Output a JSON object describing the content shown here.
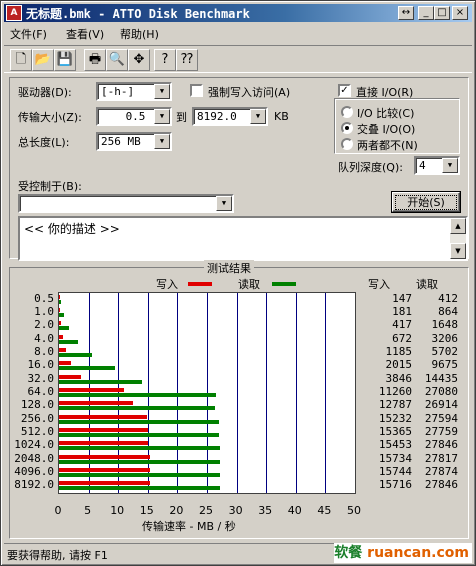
{
  "window": {
    "title": "无标题.bmk - ATTO Disk Benchmark",
    "buttons": {
      "resize": "↔",
      "minimize": "_",
      "maximize": "□",
      "close": "×"
    }
  },
  "menu": [
    "文件(F)",
    "查看(V)",
    "帮助(H)"
  ],
  "toolbar": [
    {
      "icon": "new-file-icon",
      "glyph": "🗋"
    },
    {
      "icon": "open-folder-icon",
      "glyph": "📂"
    },
    {
      "icon": "save-icon",
      "glyph": "💾"
    },
    {
      "icon": "print-icon",
      "glyph": "🖶"
    },
    {
      "icon": "print-preview-icon",
      "glyph": "🔍"
    },
    {
      "icon": "move-icon",
      "glyph": "✥"
    },
    {
      "icon": "help-icon",
      "glyph": "?"
    },
    {
      "icon": "context-help-icon",
      "glyph": "⁇"
    }
  ],
  "settings": {
    "drive_label": "驱动器(D):",
    "drive_value": "[-h-]",
    "transfer_label": "传输大小(Z):",
    "transfer_from": "0.5",
    "to_label": "到",
    "transfer_to": "8192.0",
    "kb_label": "KB",
    "length_label": "总长度(L):",
    "length_value": "256 MB",
    "force_write_label": "强制写入访问(A)",
    "force_write_checked": false,
    "direct_io_label": "直接 I/O(R)",
    "direct_io_checked": true,
    "io_compare_label": "I/O 比较(C)",
    "overlap_io_label": "交叠 I/O(O)",
    "neither_label": "两者都不(N)",
    "selected_mode": "overlap",
    "queue_label": "队列深度(Q):",
    "queue_value": "4",
    "controlled_label": "受控制于(B):",
    "controlled_value": "",
    "start_button": "开始(S)",
    "description": "<<  你的描述  >>"
  },
  "results": {
    "title": "测试结果",
    "write_legend": "写入",
    "read_legend": "读取",
    "write_header": "写入",
    "read_header": "读取",
    "xlabel": "传输速率 - MB / 秒"
  },
  "colors": {
    "write": "#e00000",
    "read": "#008000",
    "grid": "#000080"
  },
  "chart_data": {
    "type": "bar",
    "orientation": "horizontal",
    "categories": [
      "0.5",
      "1.0",
      "2.0",
      "4.0",
      "8.0",
      "16.0",
      "32.0",
      "64.0",
      "128.0",
      "256.0",
      "512.0",
      "1024.0",
      "2048.0",
      "4096.0",
      "8192.0"
    ],
    "series": [
      {
        "name": "写入",
        "values": [
          147,
          181,
          417,
          672,
          1185,
          2015,
          3846,
          11260,
          12787,
          15232,
          15365,
          15453,
          15734,
          15744,
          15716
        ]
      },
      {
        "name": "读取",
        "values": [
          412,
          864,
          1648,
          3206,
          5702,
          9675,
          14435,
          27080,
          26914,
          27594,
          27759,
          27846,
          27817,
          27874,
          27846
        ]
      }
    ],
    "value_unit_display": "KB/s",
    "xlabel": "传输速率 - MB / 秒",
    "xticks": [
      "0",
      "5",
      "10",
      "15",
      "20",
      "25",
      "30",
      "35",
      "40",
      "45",
      "50"
    ],
    "xlim": [
      0,
      50
    ],
    "grid": true,
    "legend": "top"
  },
  "status": {
    "text": "要获得帮助, 请按 F1",
    "watermark_cn": "软餐",
    "watermark_en": "ruancan.com"
  }
}
